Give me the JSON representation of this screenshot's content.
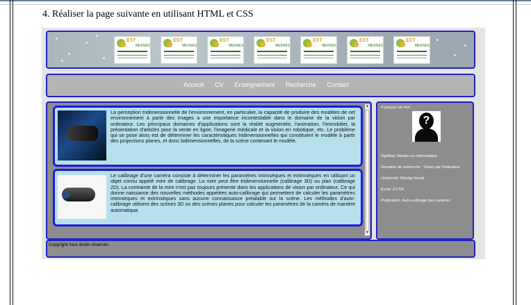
{
  "document": {
    "heading": "4. Réaliser la page suivante en utilisant HTML et CSS"
  },
  "page": {
    "nav": [
      "Acceuil",
      "CV",
      "Enseignement",
      "Recherche",
      "Contact"
    ],
    "articles": [
      {
        "text": "La perception tridimensionnelle de l'environnement, en particulier, la capacité de produire des modèles de cet environnement à partir des images a une importance incontestable dans le domaine de la vision par ordinateur. Les principaux domaines d'applications sont la réalité augmentée, l'animation, l'immobilier, la présentation d'articles pour la vente en ligne, l'imagerie médicale et la vision en robotique, etc. Le problème qui se pose alors est de déterminer les caractéristiques tridimensionnelles qui constituent le modèle à partir des projections planes, et donc bidimensionnelles, de la scène contenant le modèle."
      },
      {
        "text": "Le calibrage d'une caméra consiste à déterminer les paramètres intrinsèques et extrinsèques en utilisant un objet connu appelé mire de calibrage. La mire peut être tridimensionnelle (calibrage 3D) ou plan (calibrage 2D). La contrainte de la mire n'est pas toujours présente dans les applications de vision par ordinateur, Ce qui donne naissance des nouvelles méthodes appelées auto-calibrage qui permettent de calculer les paramètres intrinsèques et extrinsèques sans aucune connaissance préalable sur la scène. Les méthodes d'auto-calibrage utilisent des scènes 3D ou des scènes planes pour calculer les paramètres de la caméra de manière automatique."
      }
    ],
    "sidebar": {
      "about": "A propos de moi",
      "avatar_glyph": "?",
      "info": [
        "Diplôme: Master en Informatique",
        "Domaine de recherche : Vision par Ordinateur",
        "Université: Moulay Ismail",
        "Ecole: ESTM",
        "Publication: Auto-calibrage des caméras"
      ]
    },
    "footer": "Copyright tous droits réservés",
    "logo": {
      "brand": "EST",
      "city": "MEKNES"
    },
    "colors": {
      "border": "#2121c8",
      "panel": "#8d8d8d",
      "card": "#b5e0ec",
      "nav": "#b4b4b4"
    }
  }
}
